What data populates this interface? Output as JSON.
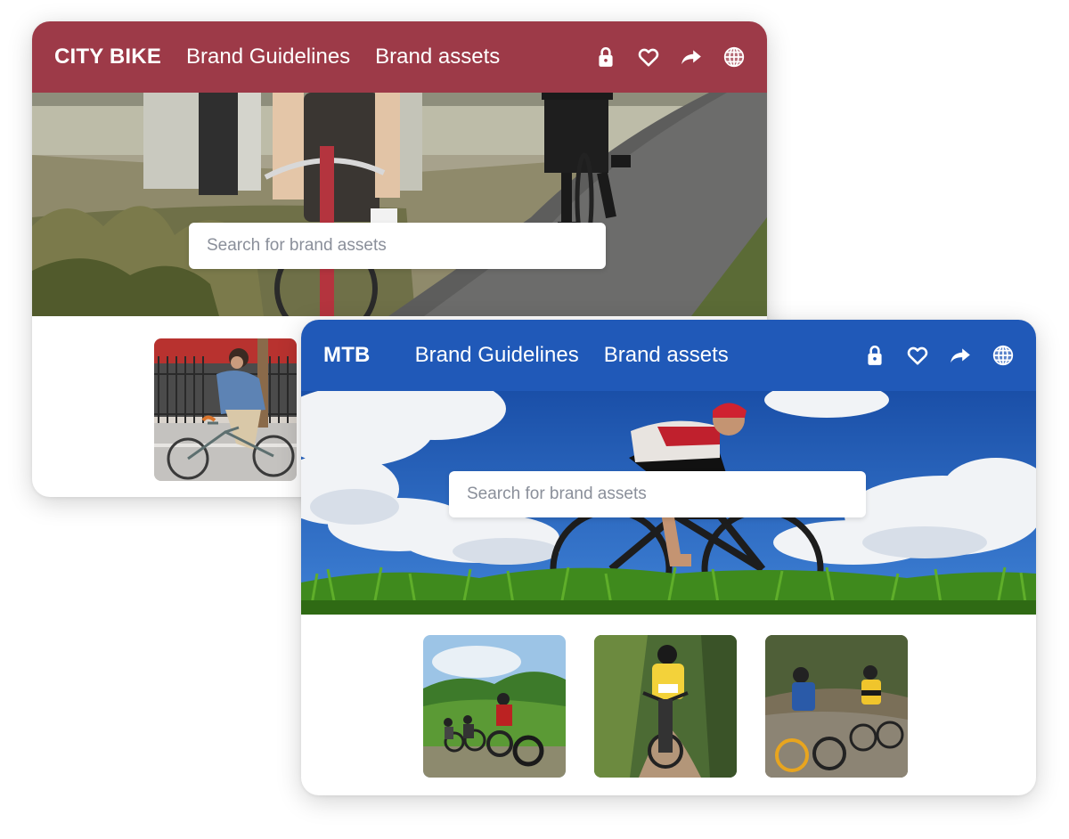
{
  "city_window": {
    "brand": "CITY BIKE",
    "nav": [
      "Brand Guidelines",
      "Brand assets"
    ],
    "search_placeholder": "Search for brand assets",
    "accent_color": "#9d3a48",
    "icons": [
      "lock-icon",
      "heart-icon",
      "share-icon",
      "globe-icon"
    ],
    "thumbnails": [
      {
        "subject": "woman-riding-city-bike-photo"
      }
    ]
  },
  "mtb_window": {
    "brand": "MTB",
    "nav": [
      "Brand Guidelines",
      "Brand assets"
    ],
    "search_placeholder": "Search for brand assets",
    "accent_color": "#2059b8",
    "icons": [
      "lock-icon",
      "heart-icon",
      "share-icon",
      "globe-icon"
    ],
    "thumbnails": [
      {
        "subject": "group-riding-fat-bikes-photo"
      },
      {
        "subject": "rider-on-dirt-trail-photo"
      },
      {
        "subject": "two-racers-dusty-trail-photo"
      }
    ]
  }
}
